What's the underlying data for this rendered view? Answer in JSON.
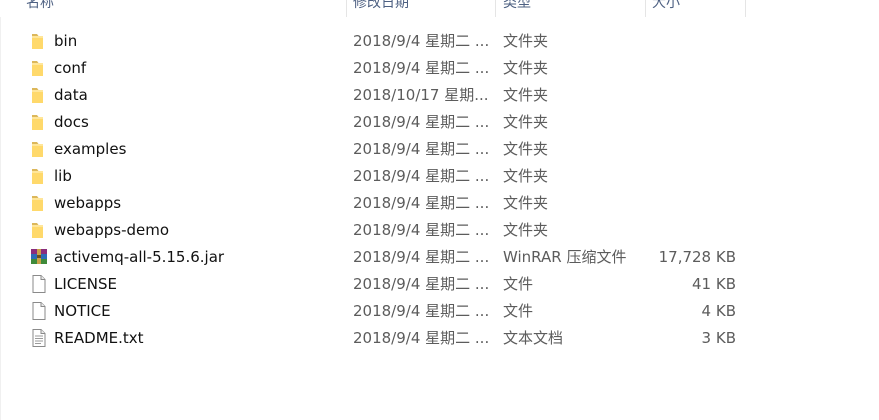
{
  "columns": {
    "name": "名称",
    "date": "修改日期",
    "type": "类型",
    "size": "大小"
  },
  "files": [
    {
      "name": "bin",
      "date": "2018/9/4 星期二 ...",
      "type": "文件夹",
      "size": "",
      "icon": "folder-icon"
    },
    {
      "name": "conf",
      "date": "2018/9/4 星期二 ...",
      "type": "文件夹",
      "size": "",
      "icon": "folder-icon"
    },
    {
      "name": "data",
      "date": "2018/10/17 星期...",
      "type": "文件夹",
      "size": "",
      "icon": "folder-icon"
    },
    {
      "name": "docs",
      "date": "2018/9/4 星期二 ...",
      "type": "文件夹",
      "size": "",
      "icon": "folder-icon"
    },
    {
      "name": "examples",
      "date": "2018/9/4 星期二 ...",
      "type": "文件夹",
      "size": "",
      "icon": "folder-icon"
    },
    {
      "name": "lib",
      "date": "2018/9/4 星期二 ...",
      "type": "文件夹",
      "size": "",
      "icon": "folder-icon"
    },
    {
      "name": "webapps",
      "date": "2018/9/4 星期二 ...",
      "type": "文件夹",
      "size": "",
      "icon": "folder-icon"
    },
    {
      "name": "webapps-demo",
      "date": "2018/9/4 星期二 ...",
      "type": "文件夹",
      "size": "",
      "icon": "folder-icon"
    },
    {
      "name": "activemq-all-5.15.6.jar",
      "date": "2018/9/4 星期二 ...",
      "type": "WinRAR 压缩文件",
      "size": "17,728 KB",
      "icon": "winrar-archive-icon"
    },
    {
      "name": "LICENSE",
      "date": "2018/9/4 星期二 ...",
      "type": "文件",
      "size": "41 KB",
      "icon": "file-icon"
    },
    {
      "name": "NOTICE",
      "date": "2018/9/4 星期二 ...",
      "type": "文件",
      "size": "4 KB",
      "icon": "file-icon"
    },
    {
      "name": "README.txt",
      "date": "2018/9/4 星期二 ...",
      "type": "文本文档",
      "size": "3 KB",
      "icon": "text-document-icon"
    }
  ]
}
